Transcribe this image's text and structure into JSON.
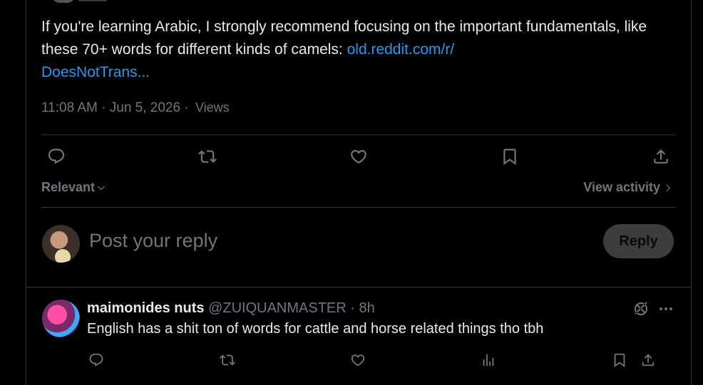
{
  "tweet": {
    "text": "If you're learning Arabic, I strongly recommend focusing on the important fundamentals, like these 70+ words for different kinds of camels: ",
    "link_text": "old.reddit.com/r/DoesNotTrans...",
    "link_part1": "old.reddit.com/r/",
    "link_part2": "DoesNotTrans...",
    "time": "11:08 AM · Jun 5, 2026 · ",
    "views_label": "Views"
  },
  "actions": {
    "reply": "reply-icon",
    "retweet": "retweet-icon",
    "like": "heart-icon",
    "bookmark": "bookmark-icon",
    "share": "share-icon"
  },
  "sort": {
    "label": "Relevant",
    "activity": "View activity"
  },
  "composer": {
    "placeholder": "Post your reply",
    "button": "Reply"
  },
  "reply_post": {
    "name": "maimonides nuts",
    "handle": "@ZUIQUANMASTER · 8h",
    "text": "English has a shit ton of words for cattle and horse related things tho tbh"
  },
  "colors": {
    "link": "#1d9bf0",
    "text": "#e7e9ea",
    "muted": "#71767b",
    "border": "#2f3336"
  }
}
